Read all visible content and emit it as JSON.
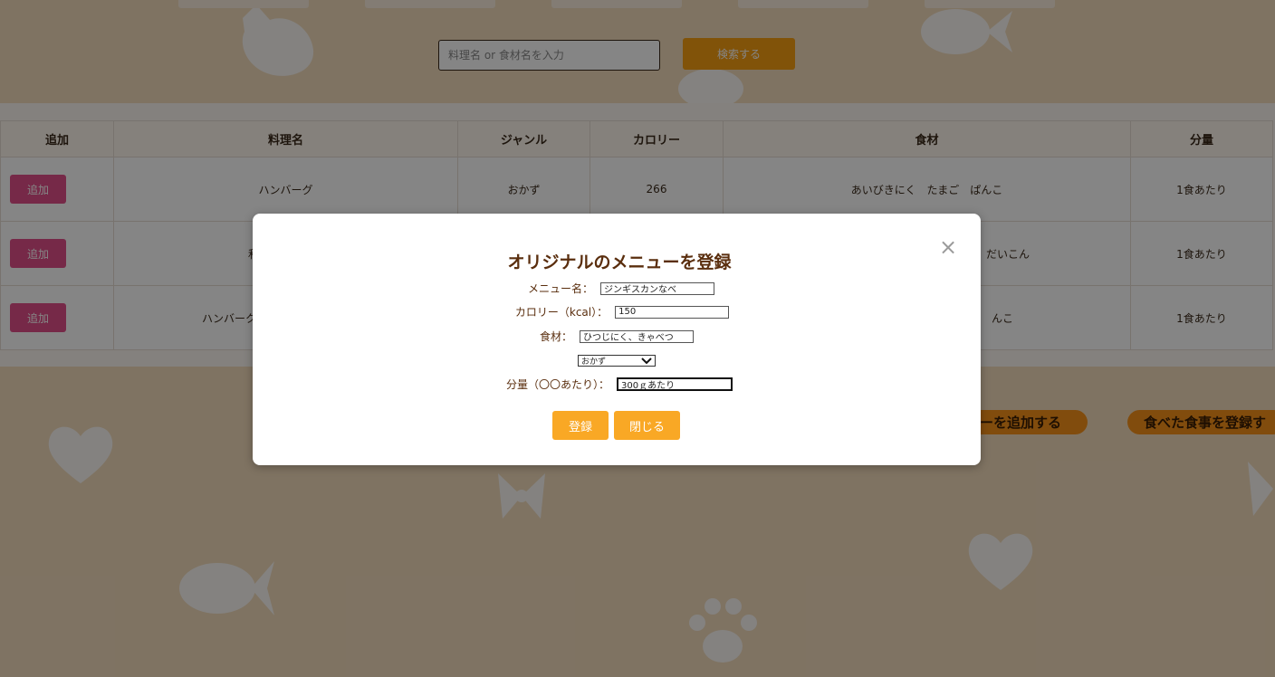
{
  "search": {
    "placeholder": "料理名 or 食材名を入力",
    "button_label": "検索する"
  },
  "table": {
    "headers": [
      "追加",
      "料理名",
      "ジャンル",
      "カロリー",
      "食材",
      "分量"
    ],
    "rows": [
      {
        "add_label": "追加",
        "name": "ハンバーグ",
        "genre": "おかず",
        "calorie": "266",
        "ingredients": "あいびきにく　たまご　ぱんこ",
        "amount": "1食あたり"
      },
      {
        "add_label": "追加",
        "name": "和",
        "genre": "",
        "calorie": "",
        "ingredients": "だいこん",
        "amount": "1食あたり"
      },
      {
        "add_label": "追加",
        "name": "ハンバーク",
        "genre": "",
        "calorie": "",
        "ingredients": "んこ",
        "amount": "1食あたり"
      }
    ]
  },
  "bottom_buttons": {
    "add_menu_label": "ーを追加する",
    "register_meal_label": "食べた食事を登録す"
  },
  "modal": {
    "title": "オリジナルのメニューを登録",
    "close_icon": "×",
    "fields": {
      "menu_name_label": "メニュー名：",
      "menu_name_value": "ジンギスカンなべ",
      "calorie_label": "カロリー（kcal）：",
      "calorie_value": "150",
      "ingredients_label": "食材：",
      "ingredients_value": "ひつじにく、きゃべつ",
      "genre_selected": "おかず",
      "amount_label": "分量（〇〇あたり）：",
      "amount_value": "300ｇあたり"
    },
    "register_label": "登録",
    "close_label": "閉じる"
  },
  "colors": {
    "background": "#f4dcbd",
    "search_button": "#f79f13",
    "add_button": "#e2508a",
    "modal_button": "#f9a825",
    "title_text": "#5a2e0e"
  }
}
